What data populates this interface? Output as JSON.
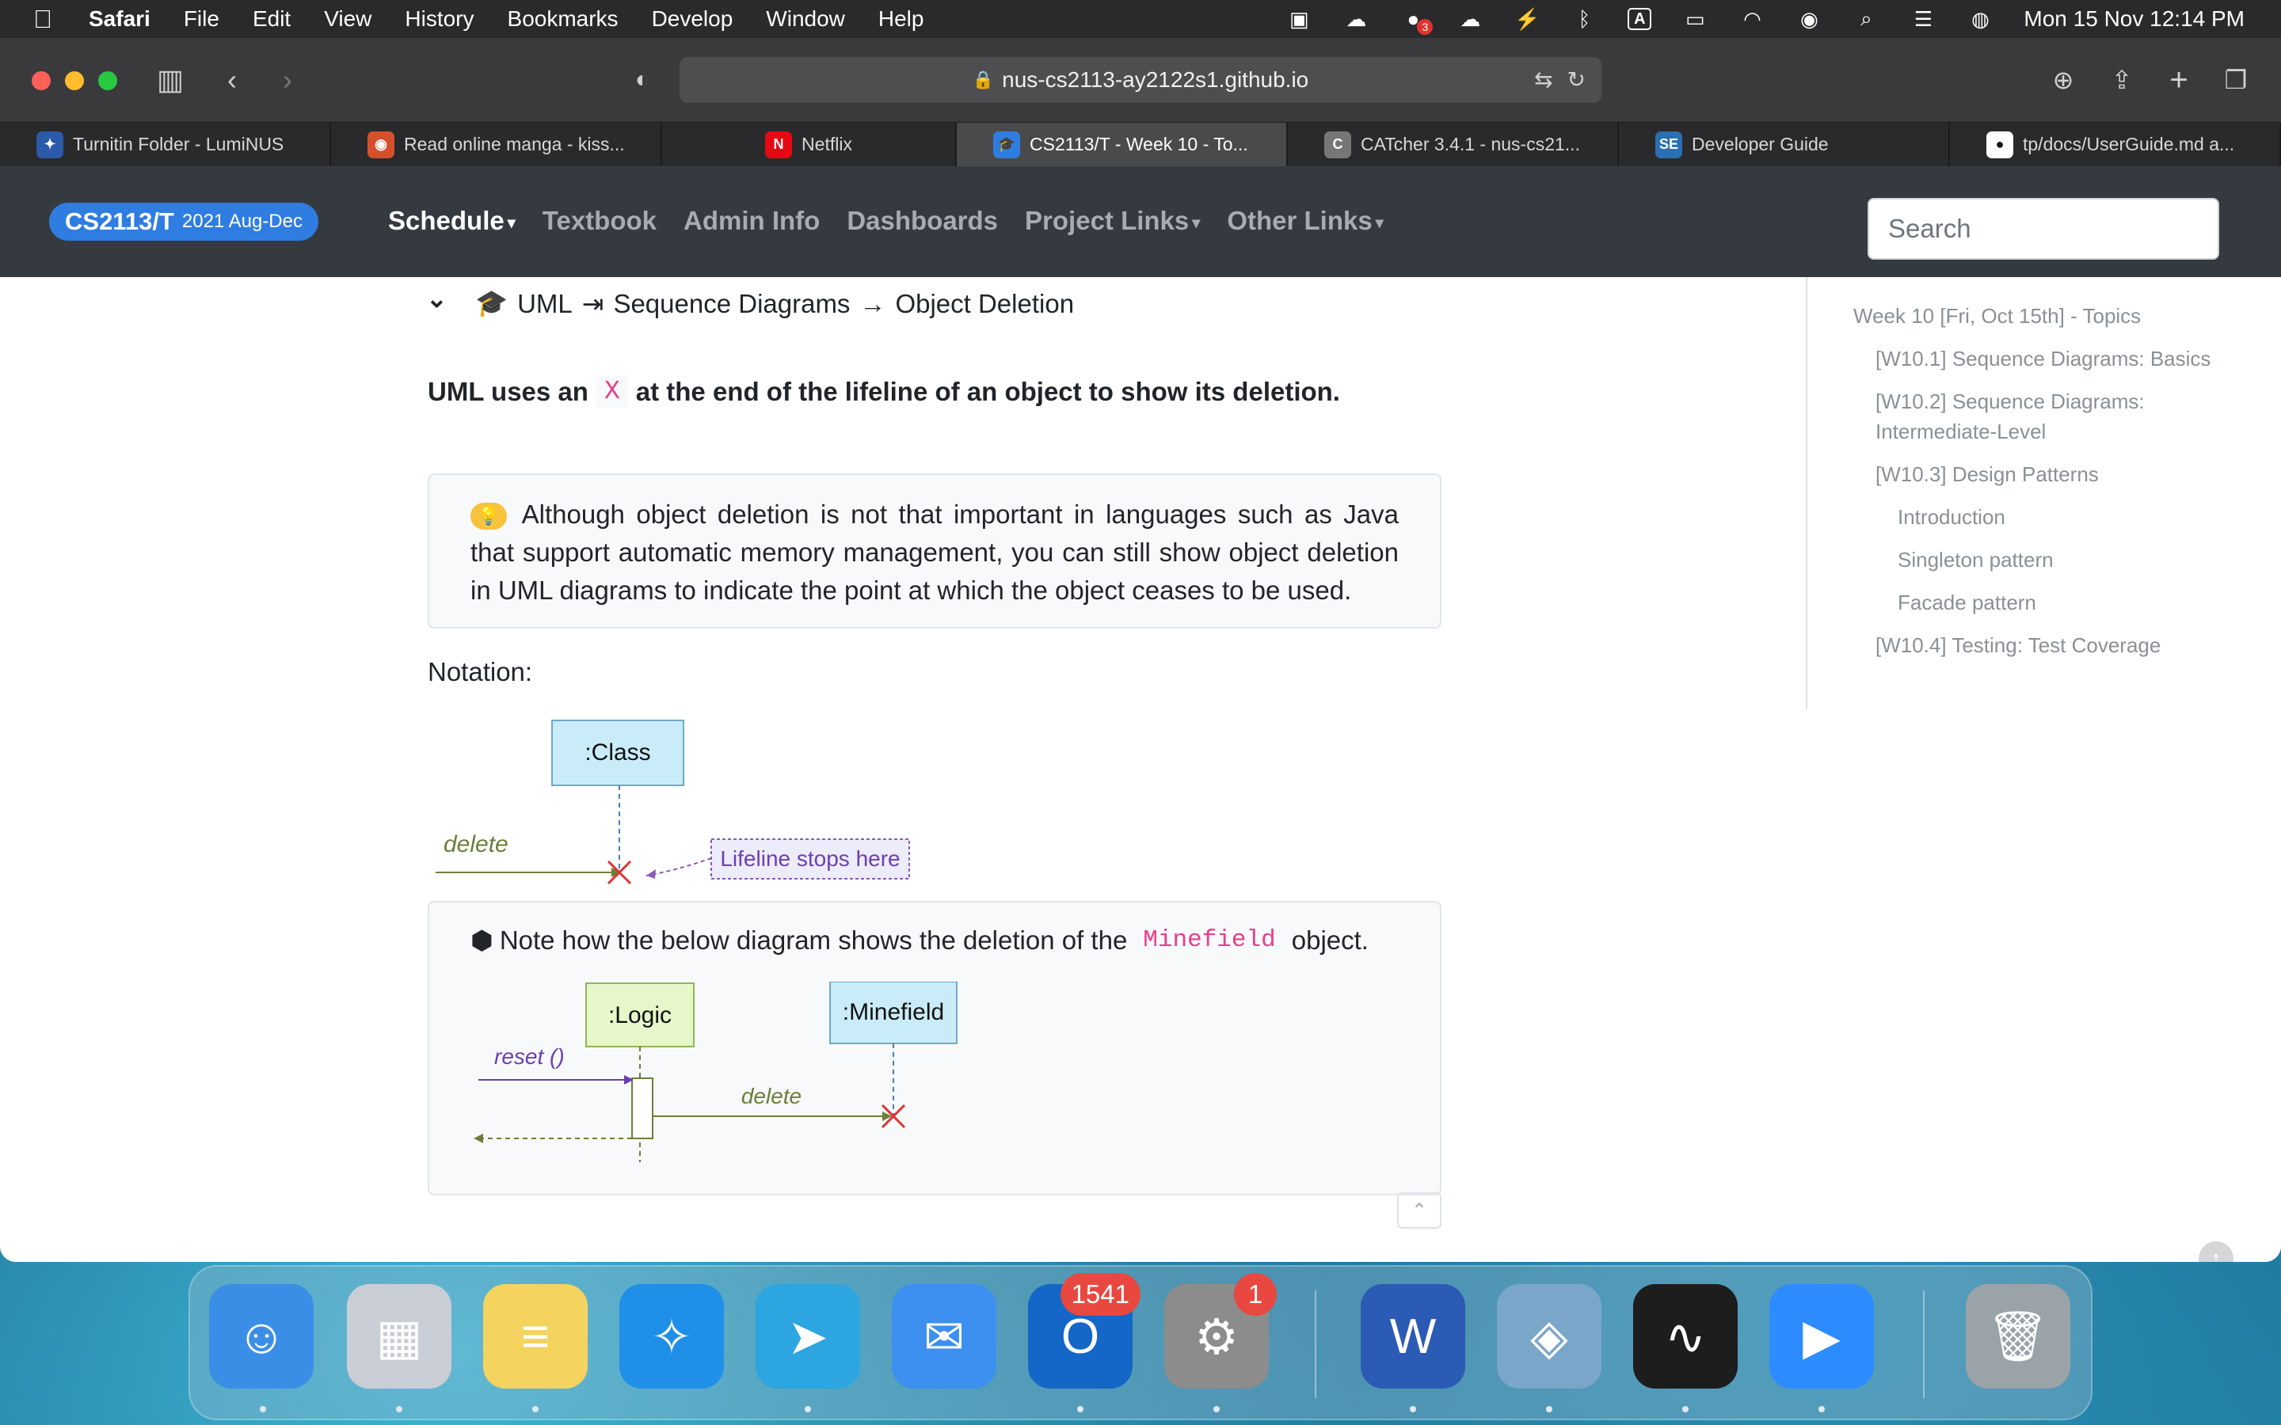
{
  "menubar": {
    "app_name": "Safari",
    "items": [
      "File",
      "Edit",
      "View",
      "History",
      "Bookmarks",
      "Develop",
      "Window",
      "Help"
    ],
    "status_badge": "3",
    "input_source": "A",
    "clock": "Mon 15 Nov  12:14 PM"
  },
  "browser": {
    "url": "nus-cs2113-ay2122s1.github.io",
    "tabs": [
      {
        "label": "Turnitin Folder - LumiNUS",
        "icon": "luminus-icon",
        "color": "#2a5aa8",
        "glyph": "✦"
      },
      {
        "label": "Read online manga - kiss...",
        "icon": "manga-icon",
        "color": "#d4502c",
        "glyph": "◉"
      },
      {
        "label": "Netflix",
        "icon": "netflix-icon",
        "color": "#e50914",
        "glyph": "N"
      },
      {
        "label": "CS2113/T - Week 10 - To...",
        "icon": "graduation-cap-icon",
        "color": "#2f7de1",
        "glyph": "🎓"
      },
      {
        "label": "CATcher 3.4.1 - nus-cs21...",
        "icon": "catcher-icon",
        "color": "#777777",
        "glyph": "C"
      },
      {
        "label": "Developer Guide",
        "icon": "se-edu-icon",
        "color": "#2a6fb0",
        "glyph": "SE"
      },
      {
        "label": "tp/docs/UserGuide.md a...",
        "icon": "github-icon",
        "color": "#ffffff",
        "glyph": "●"
      }
    ],
    "active_tab": 3
  },
  "site": {
    "brand": "CS2113/T",
    "brand_sub": "2021 Aug-Dec",
    "nav": [
      {
        "label": "Schedule",
        "dropdown": true,
        "active": true
      },
      {
        "label": "Textbook",
        "dropdown": false,
        "active": false
      },
      {
        "label": "Admin Info",
        "dropdown": false,
        "active": false
      },
      {
        "label": "Dashboards",
        "dropdown": false,
        "active": false
      },
      {
        "label": "Project Links",
        "dropdown": true,
        "active": false
      },
      {
        "label": "Other Links",
        "dropdown": true,
        "active": false
      }
    ],
    "search_placeholder": "Search"
  },
  "page": {
    "breadcrumb": {
      "part1": "UML",
      "part2": "Sequence Diagrams",
      "arrow": "→",
      "part3": "Object Deletion"
    },
    "heading_pre": "UML uses an",
    "heading_code": "X",
    "heading_post": "at the end of the lifeline of an object to show its deletion.",
    "tip": "Although object deletion is not that important in languages such as Java that support automatic memory management, you can still show object deletion in UML diagrams to indicate the point at which the object ceases to be used.",
    "notation_label": "Notation:",
    "diagram1": {
      "class_label": ":Class",
      "message": "delete",
      "note": "Lifeline stops here"
    },
    "example_pre": "Note how the below diagram shows the deletion of the",
    "example_code": "Minefield",
    "example_post": "object.",
    "diagram2": {
      "logic": ":Logic",
      "minefield": ":Minefield",
      "reset": "reset ()",
      "delete": "delete"
    }
  },
  "toc": [
    {
      "label": "Week 10 [Fri, Oct 15th] - Topics",
      "level": 0
    },
    {
      "label": "[W10.1] Sequence Diagrams: Basics",
      "level": 1
    },
    {
      "label": "[W10.2] Sequence Diagrams: Intermediate-Level",
      "level": 1
    },
    {
      "label": "[W10.3] Design Patterns",
      "level": 1
    },
    {
      "label": "Introduction",
      "level": 2
    },
    {
      "label": "Singleton pattern",
      "level": 2
    },
    {
      "label": "Facade pattern",
      "level": 2
    },
    {
      "label": "[W10.4] Testing: Test Coverage",
      "level": 1
    }
  ],
  "dock": {
    "apps": [
      {
        "name": "finder",
        "color": "#3b8ee6",
        "glyph": "☺",
        "badge": ""
      },
      {
        "name": "launchpad",
        "color": "#c9ced6",
        "glyph": "▦",
        "badge": ""
      },
      {
        "name": "notes",
        "color": "#f4d35e",
        "glyph": "≡",
        "badge": ""
      },
      {
        "name": "safari",
        "color": "#1f8fe8",
        "glyph": "✧",
        "badge": ""
      },
      {
        "name": "telegram",
        "color": "#2ca5e0",
        "glyph": "➤",
        "badge": ""
      },
      {
        "name": "mail",
        "color": "#3d8ff0",
        "glyph": "✉",
        "badge": ""
      },
      {
        "name": "outlook",
        "color": "#1466c7",
        "glyph": "O",
        "badge": "1541"
      },
      {
        "name": "system-preferences",
        "color": "#8c8c8c",
        "glyph": "⚙",
        "badge": "1"
      },
      {
        "name": "word",
        "color": "#2b5bb5",
        "glyph": "W",
        "badge": ""
      },
      {
        "name": "preview",
        "color": "#7aa6c9",
        "glyph": "◈",
        "badge": ""
      },
      {
        "name": "activity-monitor",
        "color": "#1d1d1d",
        "glyph": "∿",
        "badge": ""
      },
      {
        "name": "zoom",
        "color": "#2d8cff",
        "glyph": "▶",
        "badge": ""
      },
      {
        "name": "trash",
        "color": "#9aa3a8",
        "glyph": "🗑",
        "badge": ""
      }
    ]
  }
}
